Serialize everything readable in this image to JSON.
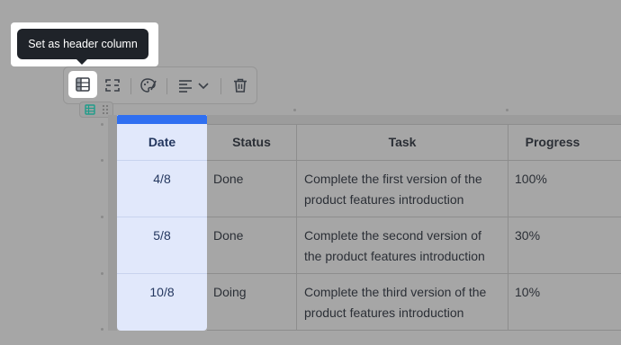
{
  "tooltip": {
    "text": "Set as header column"
  },
  "toolbar": {
    "buttons": [
      {
        "name": "header-column",
        "icon": "table-header-column-icon",
        "active": true
      },
      {
        "name": "merge-cells",
        "icon": "merge-cells-icon"
      },
      {
        "name": "cell-color",
        "icon": "palette-icon"
      },
      {
        "name": "align",
        "icon": "align-left-icon",
        "dropdown": true
      },
      {
        "name": "delete",
        "icon": "trash-icon"
      }
    ]
  },
  "table": {
    "headers": [
      "Date",
      "Status",
      "Task",
      "Progress"
    ],
    "rows": [
      {
        "date": "4/8",
        "status": "Done",
        "task_line1": "Complete the first version of the",
        "task_line2": "product  features introduction",
        "progress": "100%"
      },
      {
        "date": "5/8",
        "status": "Done",
        "task_line1": "Complete the second version of",
        "task_line2": "the product  features introduction",
        "progress": "30%"
      },
      {
        "date": "10/8",
        "status": "Doing",
        "task_line1": "Complete the third version of the",
        "task_line2": "product  features introduction",
        "progress": "10%"
      }
    ]
  },
  "colors": {
    "accent": "#2f6ff1",
    "selected_column": "#e1e8fb",
    "tooltip_bg": "#1f2329",
    "overlay": "#a6a6a6"
  }
}
